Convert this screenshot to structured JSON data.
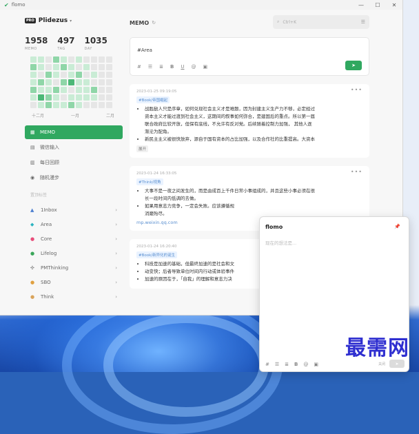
{
  "window": {
    "app_name": "flomo"
  },
  "user": {
    "badge": "PRO",
    "name": "Plidezus"
  },
  "stats": [
    {
      "value": "1958",
      "label": "MEMO"
    },
    {
      "value": "497",
      "label": "TAG"
    },
    {
      "value": "1035",
      "label": "DAY"
    }
  ],
  "heatmap": {
    "levels": [
      1,
      1,
      0,
      2,
      1,
      0,
      1,
      0,
      0,
      0,
      0,
      2,
      1,
      0,
      1,
      2,
      1,
      0,
      1,
      0,
      0,
      0,
      1,
      0,
      2,
      1,
      0,
      1,
      2,
      0,
      1,
      0,
      0,
      1,
      2,
      1,
      0,
      2,
      3,
      1,
      1,
      0,
      0,
      0,
      2,
      1,
      1,
      2,
      1,
      0,
      1,
      1,
      2,
      0,
      0,
      1,
      3,
      2,
      1,
      0,
      1,
      1,
      1,
      1,
      0,
      0,
      0,
      1,
      2,
      1,
      1,
      2,
      1,
      0,
      0,
      0,
      0
    ],
    "colors": [
      "#e6e6e6",
      "#c9ecd5",
      "#8fd6a8",
      "#4cb877"
    ],
    "months": [
      "十二月",
      "一月",
      "二月"
    ]
  },
  "nav": [
    {
      "icon": "grid-icon",
      "glyph": "▦",
      "label": "MEMO",
      "active": true
    },
    {
      "icon": "chat-icon",
      "glyph": "▤",
      "label": "微信输入"
    },
    {
      "icon": "calendar-icon",
      "glyph": "▥",
      "label": "每日回顾"
    },
    {
      "icon": "shuffle-icon",
      "glyph": "◉",
      "label": "随机漫步"
    }
  ],
  "tags_section_label": "置顶标签",
  "tags": [
    {
      "icon": "pyramid-icon",
      "glyph": "▲",
      "color": "#4d7fd0",
      "label": "1Inbox"
    },
    {
      "icon": "gem-icon",
      "glyph": "◆",
      "color": "#2bb3c0",
      "label": "Area"
    },
    {
      "icon": "speech-icon",
      "glyph": "●",
      "color": "#e84d7a",
      "label": "Core"
    },
    {
      "icon": "lifelog-icon",
      "glyph": "●",
      "color": "#3aa65a",
      "label": "Lifelog"
    },
    {
      "icon": "atom-icon",
      "glyph": "✣",
      "color": "#777777",
      "label": "PMThinking"
    },
    {
      "icon": "face-icon",
      "glyph": "●",
      "color": "#e0a040",
      "label": "SBO"
    },
    {
      "icon": "think-icon",
      "glyph": "●",
      "color": "#d9a35a",
      "label": "Think"
    }
  ],
  "main": {
    "title": "MEMO",
    "search_placeholder": "Ctrl+K",
    "editor_text": "#Area"
  },
  "memos": [
    {
      "time": "2023-01-25 09:19:05",
      "tag": "#Book/帝国崛起",
      "items": [
        "战胜敌人只是序章，如何兑现社会主义才是难题，因为封建主义生产力不够，必定经过",
        "资本主义才能过渡到社会主义，这期间的叙事如何弥合，是建国后的重点。所以第一届",
        "联合政府比较开放，但保有底线，不允许有反对党。后续随着控制力加强， 其他人逐",
        "渐沦为配角。",
        "新民主主义被很快放弃，源自于国有资本的占比加强，以及合作社的比重提高。大资本"
      ],
      "expand": "展开"
    },
    {
      "time": "2023-01-24 16:33:05",
      "tag": "#Think/视角",
      "items": [
        "大事不是一夜之间发生的，而是由成百上千件日常小事组成的，并且这些小事必须在很",
        "长一段时间内低调的去做。",
        "如果用意志力竞争，一定会失败。应该遵循规",
        "消磨殆尽。"
      ],
      "link": "mp.weixin.qq.com"
    },
    {
      "time": "2023-01-24 16:20:40",
      "tag": "#Book/新异化的诞生",
      "items": [
        "科技是加速的基础，但最终加速的是社会和文",
        "动变快；后者导致单位时间内行动或体验事件",
        "加速的原因在于，「自我」的理解和意志力决"
      ]
    }
  ],
  "popup": {
    "title": "flomo",
    "placeholder": "现在的想法是...",
    "close_label": "关闭"
  },
  "watermark": "最需网"
}
